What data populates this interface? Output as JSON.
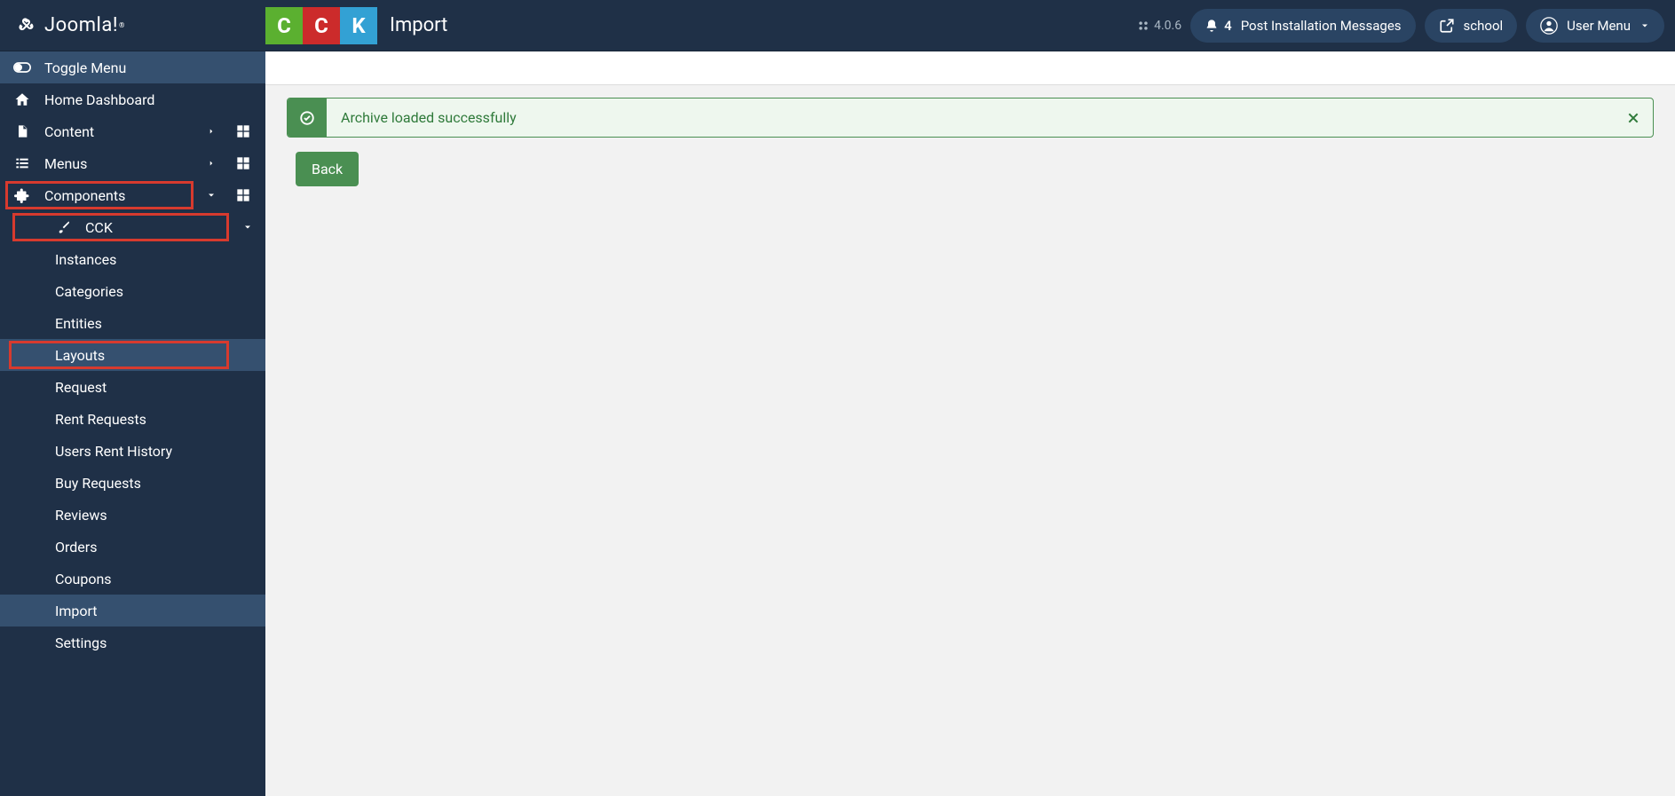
{
  "brand": "Joomla!",
  "page_title": "Import",
  "version": "4.0.6",
  "header": {
    "notif_count": "4",
    "post_install": "Post Installation Messages",
    "site_name": "school",
    "user_menu": "User Menu"
  },
  "sidebar": {
    "toggle": "Toggle Menu",
    "home": "Home Dashboard",
    "content": "Content",
    "menus": "Menus",
    "components": "Components",
    "cck": "CCK",
    "cck_items": {
      "instances": "Instances",
      "categories": "Categories",
      "entities": "Entities",
      "layouts": "Layouts",
      "request": "Request",
      "rent_requests": "Rent Requests",
      "users_rent_history": "Users Rent History",
      "buy_requests": "Buy Requests",
      "reviews": "Reviews",
      "orders": "Orders",
      "coupons": "Coupons",
      "import": "Import",
      "settings": "Settings"
    }
  },
  "alert": {
    "message": "Archive loaded successfully"
  },
  "buttons": {
    "back": "Back"
  }
}
